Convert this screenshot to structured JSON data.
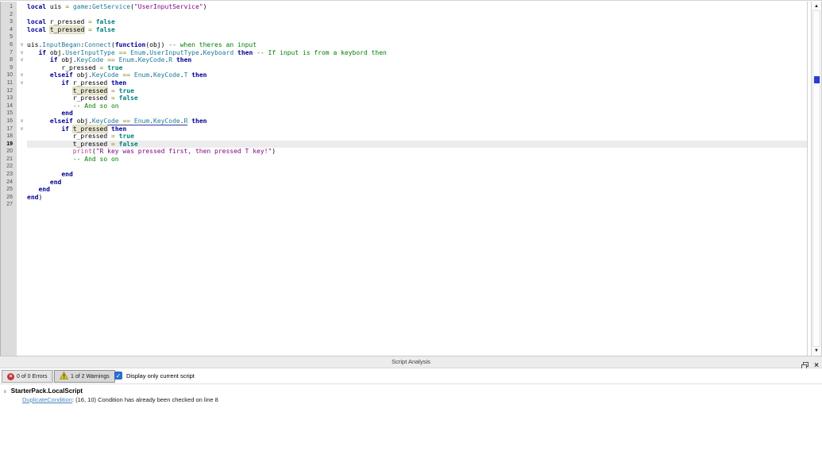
{
  "editor": {
    "current_line": 19,
    "fold_lines": [
      6,
      7,
      8,
      10,
      11,
      16,
      17
    ],
    "lines": [
      [
        [
          "kw",
          "local"
        ],
        [
          "pl",
          " uis "
        ],
        [
          "op",
          "="
        ],
        [
          "pl",
          " "
        ],
        [
          "mb",
          "game"
        ],
        [
          "pl",
          ":"
        ],
        [
          "mb",
          "GetService"
        ],
        [
          "pl",
          "("
        ],
        [
          "str",
          "\"UserInputService\""
        ],
        [
          "pl",
          ")"
        ]
      ],
      [],
      [
        [
          "kw",
          "local"
        ],
        [
          "pl",
          " r_pressed "
        ],
        [
          "op",
          "="
        ],
        [
          "pl",
          " "
        ],
        [
          "bo",
          "false"
        ]
      ],
      [
        [
          "kw",
          "local"
        ],
        [
          "pl",
          " "
        ],
        [
          "pl hl",
          "t_pressed"
        ],
        [
          "pl",
          " "
        ],
        [
          "op",
          "="
        ],
        [
          "pl",
          " "
        ],
        [
          "bo",
          "false"
        ]
      ],
      [],
      [
        [
          "pl",
          "uis."
        ],
        [
          "mb",
          "InputBegan"
        ],
        [
          "pl",
          ":"
        ],
        [
          "mb",
          "Connect"
        ],
        [
          "pl",
          "("
        ],
        [
          "kw",
          "function"
        ],
        [
          "pl",
          "(obj) "
        ],
        [
          "cm",
          "-- when theres an input"
        ]
      ],
      [
        [
          "pl",
          "\t"
        ],
        [
          "kw",
          "if"
        ],
        [
          "pl",
          " obj."
        ],
        [
          "mb",
          "UserInputType"
        ],
        [
          "pl",
          " "
        ],
        [
          "op",
          "=="
        ],
        [
          "pl",
          " "
        ],
        [
          "mb",
          "Enum"
        ],
        [
          "pl",
          "."
        ],
        [
          "mb",
          "UserInputType"
        ],
        [
          "pl",
          "."
        ],
        [
          "mb",
          "Keyboard"
        ],
        [
          "pl",
          " "
        ],
        [
          "kw",
          "then"
        ],
        [
          "pl",
          " "
        ],
        [
          "cm",
          "-- If input is from a keybord then"
        ]
      ],
      [
        [
          "pl",
          "\t\t"
        ],
        [
          "kw",
          "if"
        ],
        [
          "pl",
          " obj."
        ],
        [
          "mb",
          "KeyCode"
        ],
        [
          "pl",
          " "
        ],
        [
          "op",
          "=="
        ],
        [
          "pl",
          " "
        ],
        [
          "mb",
          "Enum"
        ],
        [
          "pl",
          "."
        ],
        [
          "mb",
          "KeyCode"
        ],
        [
          "pl",
          "."
        ],
        [
          "mb",
          "R"
        ],
        [
          "pl",
          " "
        ],
        [
          "kw",
          "then"
        ]
      ],
      [
        [
          "pl",
          "\t\t\tr_pressed "
        ],
        [
          "op",
          "="
        ],
        [
          "pl",
          " "
        ],
        [
          "bo",
          "true"
        ]
      ],
      [
        [
          "pl",
          "\t\t"
        ],
        [
          "kw",
          "elseif"
        ],
        [
          "pl",
          " obj."
        ],
        [
          "mb",
          "KeyCode"
        ],
        [
          "pl",
          " "
        ],
        [
          "op",
          "=="
        ],
        [
          "pl",
          " "
        ],
        [
          "mb",
          "Enum"
        ],
        [
          "pl",
          "."
        ],
        [
          "mb",
          "KeyCode"
        ],
        [
          "pl",
          "."
        ],
        [
          "mb",
          "T"
        ],
        [
          "pl",
          " "
        ],
        [
          "kw",
          "then"
        ]
      ],
      [
        [
          "pl",
          "\t\t\t"
        ],
        [
          "kw",
          "if"
        ],
        [
          "pl",
          " r_pressed "
        ],
        [
          "kw",
          "then"
        ]
      ],
      [
        [
          "pl",
          "\t\t\t\t"
        ],
        [
          "pl hl",
          "t_pressed"
        ],
        [
          "pl",
          " "
        ],
        [
          "op",
          "="
        ],
        [
          "pl",
          " "
        ],
        [
          "bo",
          "true"
        ]
      ],
      [
        [
          "pl",
          "\t\t\t\tr_pressed "
        ],
        [
          "op",
          "="
        ],
        [
          "pl",
          " "
        ],
        [
          "bo",
          "false"
        ]
      ],
      [
        [
          "pl",
          "\t\t\t\t"
        ],
        [
          "cm",
          "-- And so on"
        ]
      ],
      [
        [
          "pl",
          "\t\t\t"
        ],
        [
          "kw",
          "end"
        ]
      ],
      [
        [
          "pl",
          "\t\t"
        ],
        [
          "kw",
          "elseif"
        ],
        [
          "pl",
          " "
        ],
        [
          "pl u",
          "obj."
        ],
        [
          "mb u",
          "KeyCode"
        ],
        [
          "pl u",
          " "
        ],
        [
          "op u",
          "=="
        ],
        [
          "pl u",
          " "
        ],
        [
          "mb u",
          "Enum"
        ],
        [
          "pl u",
          "."
        ],
        [
          "mb u",
          "KeyCode"
        ],
        [
          "pl u",
          "."
        ],
        [
          "mb u",
          "R"
        ],
        [
          "pl",
          " "
        ],
        [
          "kw",
          "then"
        ]
      ],
      [
        [
          "pl",
          "\t\t\t"
        ],
        [
          "kw",
          "if"
        ],
        [
          "pl",
          " "
        ],
        [
          "pl hl",
          "t_pressed"
        ],
        [
          "pl",
          " "
        ],
        [
          "kw",
          "then"
        ]
      ],
      [
        [
          "pl",
          "\t\t\t\tr_pressed "
        ],
        [
          "op",
          "="
        ],
        [
          "pl",
          " "
        ],
        [
          "bo",
          "true"
        ]
      ],
      [
        [
          "pl",
          "\t\t\t\tt_pressed "
        ],
        [
          "op",
          "="
        ],
        [
          "pl",
          " "
        ],
        [
          "bo",
          "false"
        ]
      ],
      [
        [
          "pl",
          "\t\t\t\t"
        ],
        [
          "fn",
          "print"
        ],
        [
          "pl",
          "("
        ],
        [
          "str",
          "\"R key was pressed first, then pressed T key!\""
        ],
        [
          "pl",
          ")"
        ]
      ],
      [
        [
          "pl",
          "\t\t\t\t"
        ],
        [
          "cm",
          "-- And so on"
        ]
      ],
      [],
      [
        [
          "pl",
          "\t\t\t"
        ],
        [
          "kw",
          "end"
        ]
      ],
      [
        [
          "pl",
          "\t\t"
        ],
        [
          "kw",
          "end"
        ]
      ],
      [
        [
          "pl",
          "\t"
        ],
        [
          "kw",
          "end"
        ]
      ],
      [
        [
          "kw",
          "end"
        ],
        [
          "pl",
          ")"
        ]
      ],
      []
    ]
  },
  "panel": {
    "title": "Script Analysis",
    "errors_button": "0 of 0 Errors",
    "warnings_button": "1 of 2 Warnings",
    "checkbox_label": "Display only current script",
    "checkbox_checked": true,
    "tree": {
      "script_name": "StarterPack.LocalScript",
      "warning_link": "DuplicateCondition",
      "warning_message": ": (16, 10) Condition has already been checked on line 8"
    }
  },
  "icons": {
    "check": "✓",
    "close": "×",
    "error_x": "×",
    "chevron": "∨",
    "scroll_up": "▲",
    "scroll_down": "▼"
  },
  "colors": {
    "error_icon": "#c83232",
    "warning_icon": "#e3bf1e",
    "link": "#4a84c4",
    "checkbox": "#2a6fd3",
    "scroll_marker": "#2b3bd6",
    "current_line_bg": "#ececec"
  }
}
